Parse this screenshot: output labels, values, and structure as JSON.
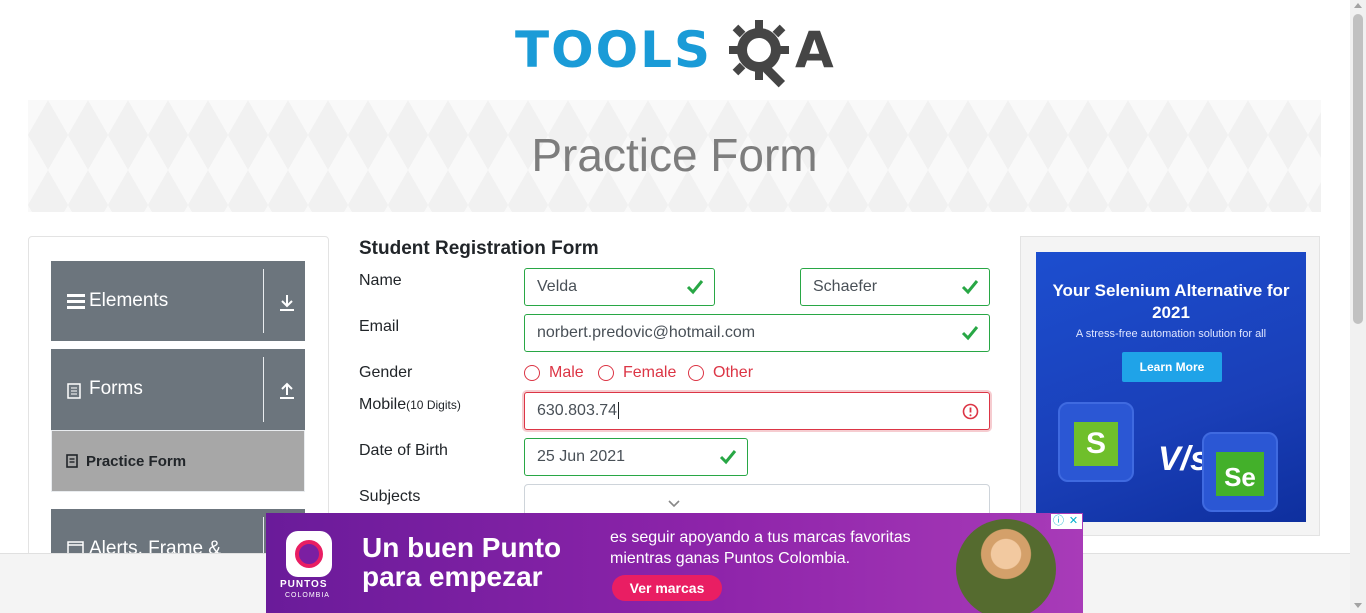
{
  "logo": {
    "text_main": "TOOLS",
    "text_end": "A"
  },
  "banner": {
    "title": "Practice Form"
  },
  "sidebar": {
    "groups": [
      {
        "label": "Elements",
        "icon": "menu-icon",
        "arrow": "download-arrow-icon"
      },
      {
        "label": "Forms",
        "icon": "document-icon",
        "arrow": "upload-arrow-icon"
      },
      {
        "label": "Alerts, Frame &",
        "icon": "window-icon"
      }
    ],
    "active_item": {
      "label": "Practice Form",
      "icon": "form-icon"
    }
  },
  "form": {
    "title": "Student Registration Form",
    "name_label": "Name",
    "first_name": "Velda",
    "last_name": "Schaefer",
    "email_label": "Email",
    "email": "norbert.predovic@hotmail.com",
    "gender_label": "Gender",
    "gender_options": [
      "Male",
      "Female",
      "Other"
    ],
    "mobile_label": "Mobile",
    "mobile_hint": "(10 Digits)",
    "mobile": "630.803.74",
    "dob_label": "Date of Birth",
    "dob": "25 Jun 2021",
    "subjects_label": "Subjects",
    "valid_color": "#28a745",
    "invalid_color": "#dc3545"
  },
  "ad_right": {
    "headline": "Your Selenium Alternative for 2021",
    "subline": "A stress-free automation solution for all",
    "button": "Learn More",
    "vs": "V/s",
    "left_tile_letter": "S",
    "right_tile_letters": "Se"
  },
  "ad_bottom": {
    "headline_line1": "Un buen Punto",
    "headline_line2": "para empezar",
    "desc_line1": "es seguir apoyando a tus marcas favoritas",
    "desc_line2": "mientras ganas Puntos Colombia.",
    "cta": "Ver marcas",
    "brand": "PUNTOS",
    "brand_sub": "COLOMBIA"
  }
}
